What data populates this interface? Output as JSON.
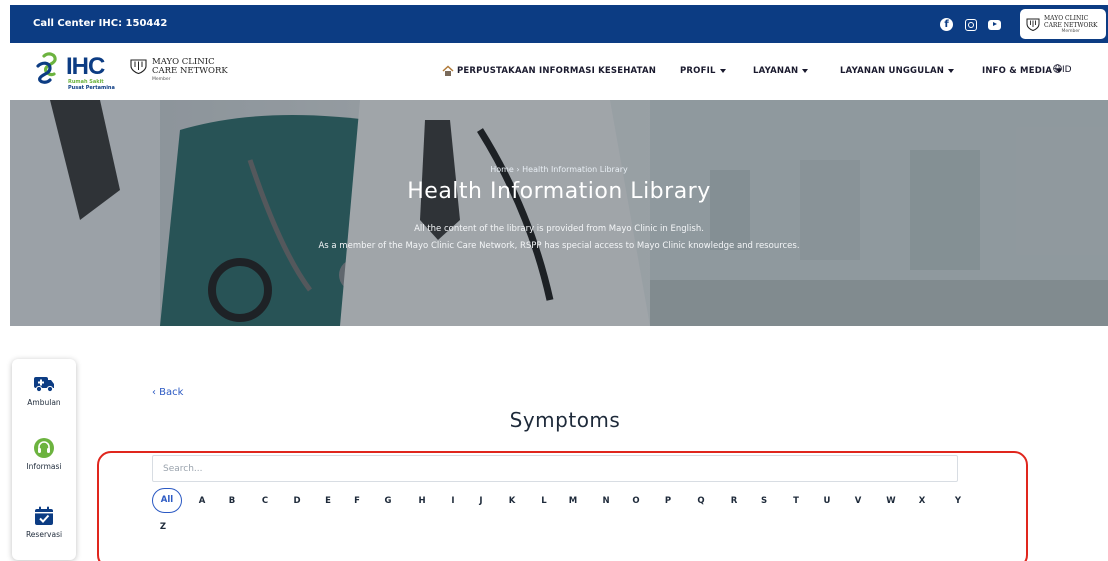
{
  "topbar": {
    "call_center": "Call Center IHC: 150442",
    "social_icons": [
      "facebook-icon",
      "instagram-icon",
      "youtube-icon"
    ],
    "badge": {
      "name_line1": "MAYO CLINIC",
      "name_line2": "CARE NETWORK",
      "member": "Member"
    }
  },
  "brand": {
    "logo_text": "IHC",
    "logo_sub1": "Rumah Sakit",
    "logo_sub2": "Pusat Pertamina",
    "mayo_line1": "MAYO CLINIC",
    "mayo_line2": "CARE NETWORK",
    "mayo_member": "Member"
  },
  "nav": {
    "items": [
      {
        "label": "PERPUSTAKAAN INFORMASI KESEHATAN",
        "dropdown": false
      },
      {
        "label": "PROFIL",
        "dropdown": true
      },
      {
        "label": "LAYANAN",
        "dropdown": true
      },
      {
        "label": "LAYANAN UNGGULAN",
        "dropdown": true
      },
      {
        "label": "INFO & MEDIA",
        "dropdown": true
      }
    ],
    "language": "ID"
  },
  "hero": {
    "breadcrumb": "Home  ›  Health Information Library",
    "title": "Health Information Library",
    "subtitle_line1": "All the content of the library is provided from Mayo Clinic in English.",
    "subtitle_line2": "As a member of the Mayo Clinic Care Network, RSPP has special access to Mayo Clinic knowledge and resources."
  },
  "sidepanel": {
    "items": [
      {
        "label": "Ambulan",
        "icon": "ambulance-icon"
      },
      {
        "label": "Informasi",
        "icon": "headset-icon"
      },
      {
        "label": "Reservasi",
        "icon": "calendar-check-icon"
      }
    ]
  },
  "content": {
    "back_label": "‹ Back",
    "title": "Symptoms",
    "search_placeholder": "Search...",
    "all_label": "All",
    "letters": [
      "A",
      "B",
      "C",
      "D",
      "E",
      "F",
      "G",
      "H",
      "I",
      "J",
      "K",
      "L",
      "M",
      "N",
      "O",
      "P",
      "Q",
      "R",
      "S",
      "T",
      "U",
      "V",
      "W",
      "X",
      "Y",
      "Z"
    ]
  },
  "colors": {
    "brand_blue": "#0c3c83",
    "brand_green": "#6cb33f",
    "link_blue": "#2b59c3",
    "highlight_red": "#e0261d"
  }
}
